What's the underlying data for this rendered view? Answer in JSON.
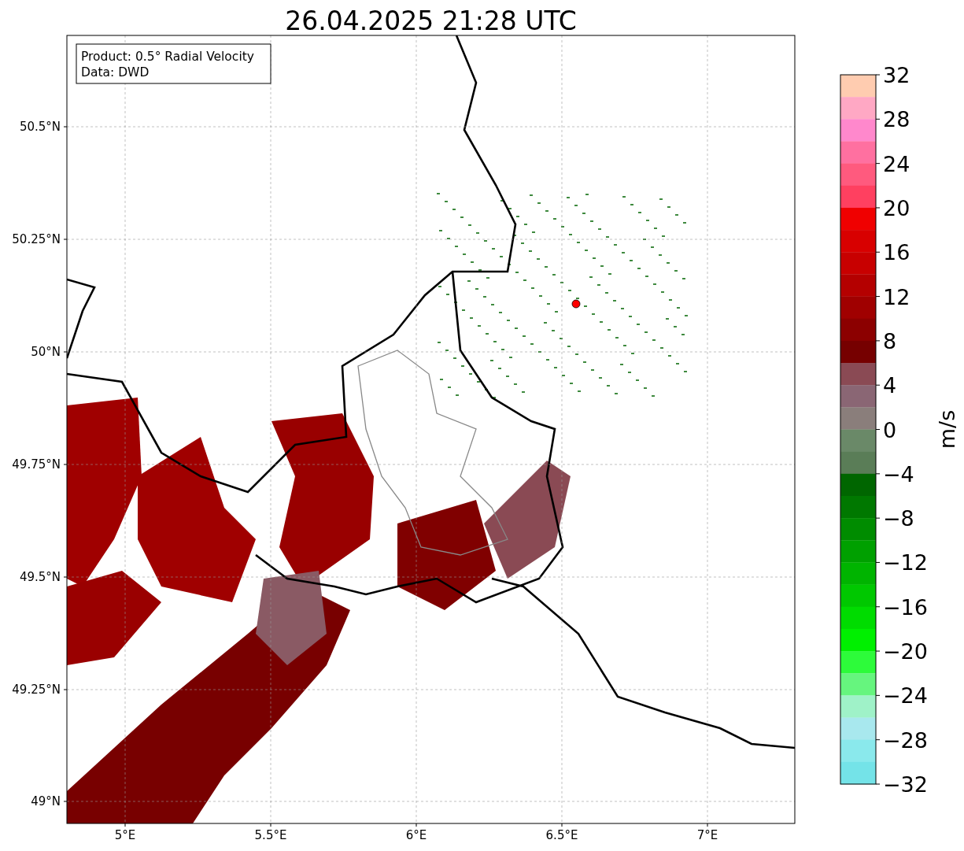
{
  "title": "26.04.2025 21:28 UTC",
  "info_box": [
    "Product: 0.5° Radial Velocity",
    "Data: DWD"
  ],
  "x_ticks": [
    "5°E",
    "5.5°E",
    "6°E",
    "6.5°E",
    "7°E"
  ],
  "y_ticks": [
    "50.5°N",
    "50.25°N",
    "50°N",
    "49.75°N",
    "49.5°N",
    "49.25°N",
    "49°N"
  ],
  "colorbar": {
    "label": "m/s",
    "ticks": [
      "32",
      "28",
      "24",
      "20",
      "16",
      "12",
      "8",
      "4",
      "0",
      "−4",
      "−8",
      "−12",
      "−16",
      "−20",
      "−24",
      "−28",
      "−32"
    ],
    "bands": [
      {
        "color": "#ffccb0"
      },
      {
        "color": "#ffa8c4"
      },
      {
        "color": "#ff88cc"
      },
      {
        "color": "#ff70a0"
      },
      {
        "color": "#ff5a7e"
      },
      {
        "color": "#ff4060"
      },
      {
        "color": "#f00000"
      },
      {
        "color": "#d80000"
      },
      {
        "color": "#c80000"
      },
      {
        "color": "#b40000"
      },
      {
        "color": "#a00000"
      },
      {
        "color": "#8c0000"
      },
      {
        "color": "#760000"
      },
      {
        "color": "#8a4a54"
      },
      {
        "color": "#8a6674"
      },
      {
        "color": "#8a7e7b"
      },
      {
        "color": "#6a8968"
      },
      {
        "color": "#5a7d57"
      },
      {
        "color": "#006600"
      },
      {
        "color": "#007800"
      },
      {
        "color": "#008c00"
      },
      {
        "color": "#00a000"
      },
      {
        "color": "#00b400"
      },
      {
        "color": "#00c800"
      },
      {
        "color": "#00dc00"
      },
      {
        "color": "#00f000"
      },
      {
        "color": "#2dfb3a"
      },
      {
        "color": "#66f57e"
      },
      {
        "color": "#9ff2c8"
      },
      {
        "color": "#a8e8ee"
      },
      {
        "color": "#8ae9ec"
      },
      {
        "color": "#74e3e8"
      }
    ]
  }
}
